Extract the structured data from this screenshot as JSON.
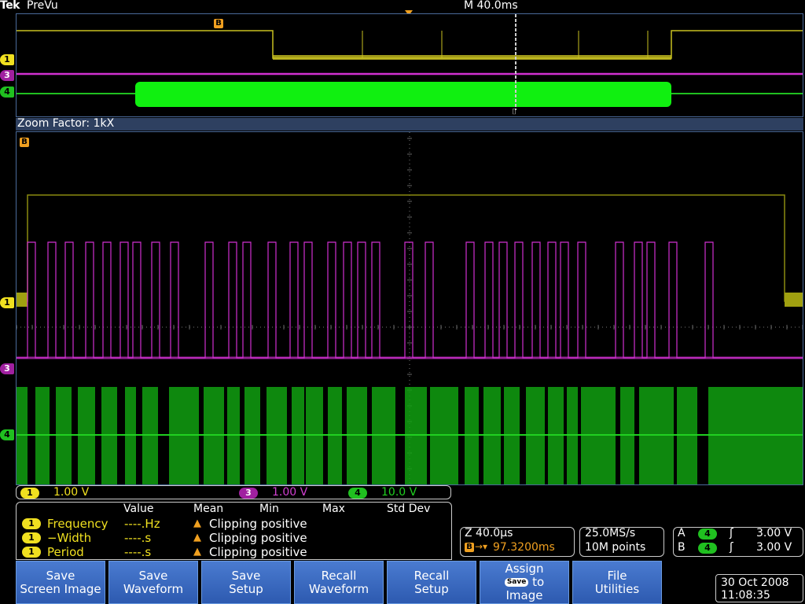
{
  "header": {
    "logo": "Tek",
    "mode": "PreVu",
    "timebase": "M 40.0ms"
  },
  "overview": {
    "b_marker": "B",
    "zoom_box_marker": "⌷",
    "channels": {
      "ch1": "1",
      "ch3": "3",
      "ch4": "4"
    }
  },
  "zoom": {
    "factor_text": "Zoom Factor: 1kX",
    "b_marker": "B"
  },
  "channel_scales": [
    {
      "channel": "1",
      "scale": "1.00 V",
      "color": "#f0e020"
    },
    {
      "channel": "3",
      "scale": "1.00 V",
      "color": "#d040d0"
    },
    {
      "channel": "4",
      "scale": "10.0 V",
      "color": "#20d020"
    }
  ],
  "measurements": {
    "headers": {
      "value": "Value",
      "mean": "Mean",
      "min": "Min",
      "max": "Max",
      "std": "Std Dev"
    },
    "rows": [
      {
        "channel": "1",
        "name": "Frequency",
        "value": "----.Hz",
        "status": "Clipping positive"
      },
      {
        "channel": "1",
        "name": "−Width",
        "value": "----.s",
        "status": "Clipping positive"
      },
      {
        "channel": "1",
        "name": "Period",
        "value": "----.s",
        "status": "Clipping positive"
      }
    ]
  },
  "zoom_readout": {
    "zoom_scale": "Z 40.0µs",
    "b_pos_label": "B",
    "b_pos": "97.3200ms"
  },
  "acq_readout": {
    "rate": "25.0MS/s",
    "points": "10M points"
  },
  "trigger_readout": {
    "a_label": "A",
    "a_source": "4",
    "a_level": "3.00 V",
    "b_label": "B",
    "b_source": "4",
    "b_level": "3.00 V"
  },
  "buttons": [
    {
      "l1": "Save",
      "l2": "Screen Image"
    },
    {
      "l1": "Save",
      "l2": "Waveform"
    },
    {
      "l1": "Save",
      "l2": "Setup"
    },
    {
      "l1": "Recall",
      "l2": "Waveform"
    },
    {
      "l1": "Recall",
      "l2": "Setup"
    },
    {
      "l1": "Assign",
      "chip": "Save",
      "l2": "to",
      "l3": "Image"
    },
    {
      "l1": "File",
      "l2": "Utilities"
    }
  ],
  "datetime": {
    "date": "30 Oct  2008",
    "time": "11:08:35"
  },
  "colors": {
    "ch1": "#f0e020",
    "ch3": "#d040d0",
    "ch4": "#20d020",
    "b_marker": "#f0a020",
    "button": "#3a6ac0"
  }
}
